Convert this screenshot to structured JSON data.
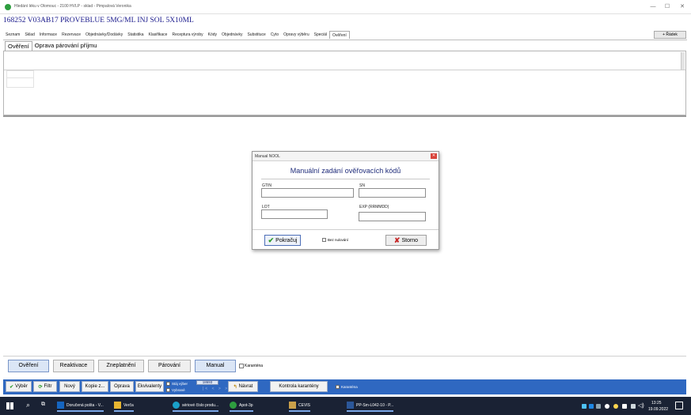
{
  "window": {
    "title": "Hledání léku v Olomouc - 2100 HVLP - sklad - Pimpalová Veronika",
    "controls": [
      "—",
      "☐",
      "✕"
    ]
  },
  "product": {
    "title": "168252 V03AB17 PROVEBLUE 5MG/ML INJ SOL 5X10ML"
  },
  "main_tabs": [
    {
      "label": "Seznam"
    },
    {
      "label": "Sklad"
    },
    {
      "label": "Informace"
    },
    {
      "label": "Rezervace"
    },
    {
      "label": "Objednávky/Dodávky"
    },
    {
      "label": "Statistika"
    },
    {
      "label": "Klasifikace"
    },
    {
      "label": "Receptura výroby"
    },
    {
      "label": "Kódy"
    },
    {
      "label": "Objednávky"
    },
    {
      "label": "Substituce"
    },
    {
      "label": "Cyto"
    },
    {
      "label": "Opravy výběru"
    },
    {
      "label": "Speciál"
    },
    {
      "label": "Ověření"
    }
  ],
  "new_record_label": "+ Řádek",
  "sub_tabs": [
    {
      "label": "Ověření"
    },
    {
      "label": "Oprava párování příjmu"
    }
  ],
  "dialog": {
    "title": "Manual NOOL",
    "heading": "Manuální zadání ověřovacích kódů",
    "fields": {
      "gtin": {
        "label": "GTIN",
        "value": ""
      },
      "sn": {
        "label": "SN",
        "value": ""
      },
      "lot": {
        "label": "LOT",
        "value": ""
      },
      "exp": {
        "label": "EXP (RRMMDD)",
        "value": ""
      }
    },
    "continue_label": "Pokračuj",
    "no_zeroing_label": "Bez nulování",
    "cancel_label": "Storno",
    "colors": {
      "heading": "#1f2c7a",
      "close": "#d9443b"
    }
  },
  "actions": {
    "verify": "Ověření",
    "reactivate": "Reaktivace",
    "invalidate": "Zneplatnění",
    "pairing": "Párování",
    "manual": "Manual",
    "quarantine": "Karanténa"
  },
  "toolbar": {
    "select": "Výběr",
    "filter": "Filtr",
    "new": "Nový",
    "copy": "Kopie z...",
    "edit": "Oprava",
    "equivalents": "Ekvivalenty",
    "select_all_label": "Stáj výber",
    "selected_label": "Vybrané",
    "counter": "18693",
    "nav": "|< < > >|",
    "back": "Návrat",
    "quarantine_check": "Kontrola karantény",
    "quarantine_label": "Karanténa",
    "color": "#2f68c1"
  },
  "taskbar": {
    "items": [
      {
        "label": "Doručená pošta - V..."
      },
      {
        "label": "Verča"
      },
      {
        "label": "sériové číslo produ..."
      },
      {
        "label": "Apot-3p"
      },
      {
        "label": "CEVIS"
      },
      {
        "label": "PP-Sm-L042-10 - P..."
      }
    ],
    "time": "13:25",
    "date": "19.09.2022"
  }
}
